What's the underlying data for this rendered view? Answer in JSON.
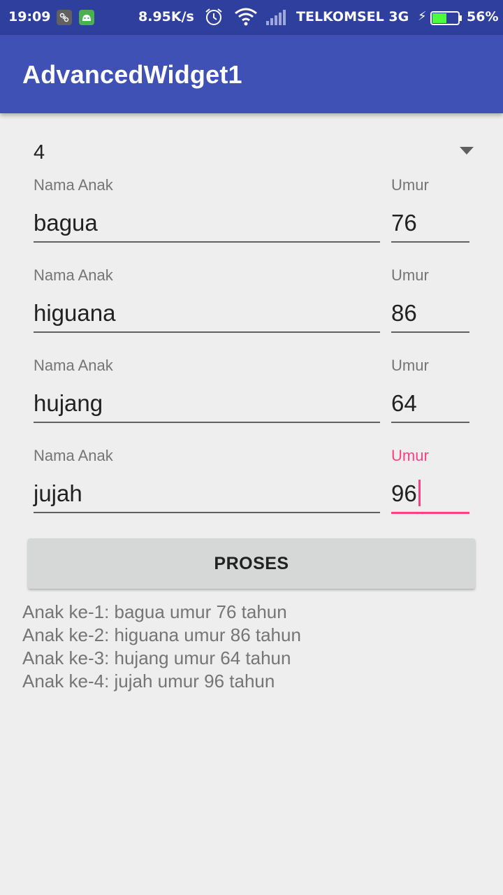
{
  "status_bar": {
    "time": "19:09",
    "speed": "8.95K/s",
    "carrier": "TELKOMSEL 3G",
    "battery_percent": "56%",
    "battery_level": 0.56,
    "icons": [
      "notification-icon",
      "android-icon",
      "alarm-icon",
      "wifi-icon",
      "signal-icon",
      "charging-icon",
      "battery-icon"
    ]
  },
  "app_bar": {
    "title": "AdvancedWidget1"
  },
  "spinner": {
    "value": "4"
  },
  "rows": [
    {
      "name_label": "Nama Anak",
      "name": "bagua",
      "age_label": "Umur",
      "age": "76"
    },
    {
      "name_label": "Nama Anak",
      "name": "higuana",
      "age_label": "Umur",
      "age": "86"
    },
    {
      "name_label": "Nama Anak",
      "name": "hujang",
      "age_label": "Umur",
      "age": "64"
    },
    {
      "name_label": "Nama Anak",
      "name": "jujah",
      "age_label": "Umur",
      "age": "96"
    }
  ],
  "button": {
    "label": "PROSES"
  },
  "results": [
    "Anak ke-1: bagua umur 76 tahun",
    "Anak ke-2: higuana umur 86 tahun",
    "Anak ke-3: hujang umur 64 tahun",
    "Anak ke-4: jujah umur 96 tahun"
  ],
  "colors": {
    "status_bar": "#2f3f9e",
    "primary": "#3f51b5",
    "accent": "#ff4081",
    "background": "#eeeeee",
    "button": "#d6d7d7"
  }
}
